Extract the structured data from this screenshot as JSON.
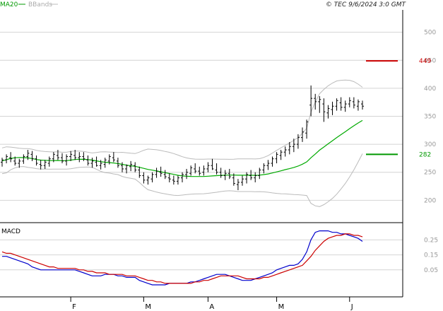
{
  "header": {
    "legend_items": [
      {
        "label": "MA20",
        "color": "#009900"
      },
      {
        "label": "BBands",
        "color": "#bbbbbb"
      }
    ],
    "timestamp": "© TEC 9/6/2024 3:0 GMT"
  },
  "chart_data": [
    {
      "type": "line",
      "name": "price-panel",
      "ylim": [
        160,
        540
      ],
      "y_ticks": [
        200,
        250,
        300,
        350,
        400,
        450,
        500
      ],
      "y_tick_labels": [
        "200",
        "250",
        "300",
        "350",
        "400",
        "450",
        "500"
      ],
      "x_tick_labels": [
        "F",
        "M",
        "A",
        "M",
        "J"
      ],
      "grid": true,
      "price_bars": [
        [
          268,
          276,
          260,
          272
        ],
        [
          272,
          282,
          266,
          278
        ],
        [
          276,
          286,
          268,
          274
        ],
        [
          270,
          278,
          262,
          266
        ],
        [
          266,
          274,
          258,
          270
        ],
        [
          270,
          282,
          265,
          278
        ],
        [
          278,
          290,
          272,
          284
        ],
        [
          282,
          288,
          270,
          274
        ],
        [
          274,
          280,
          262,
          266
        ],
        [
          264,
          272,
          255,
          262
        ],
        [
          262,
          272,
          256,
          268
        ],
        [
          266,
          278,
          260,
          274
        ],
        [
          274,
          286,
          268,
          282
        ],
        [
          280,
          290,
          272,
          276
        ],
        [
          276,
          284,
          266,
          270
        ],
        [
          270,
          282,
          262,
          278
        ],
        [
          278,
          288,
          270,
          282
        ],
        [
          280,
          290,
          272,
          276
        ],
        [
          276,
          286,
          268,
          278
        ],
        [
          278,
          286,
          270,
          274
        ],
        [
          272,
          280,
          262,
          266
        ],
        [
          266,
          276,
          258,
          270
        ],
        [
          268,
          278,
          260,
          262
        ],
        [
          262,
          272,
          255,
          266
        ],
        [
          264,
          276,
          258,
          272
        ],
        [
          270,
          282,
          264,
          278
        ],
        [
          276,
          286,
          268,
          272
        ],
        [
          270,
          276,
          258,
          262
        ],
        [
          262,
          268,
          250,
          256
        ],
        [
          256,
          264,
          248,
          262
        ],
        [
          260,
          270,
          252,
          264
        ],
        [
          262,
          268,
          250,
          254
        ],
        [
          254,
          260,
          240,
          244
        ],
        [
          244,
          250,
          230,
          236
        ],
        [
          236,
          244,
          228,
          240
        ],
        [
          238,
          250,
          232,
          246
        ],
        [
          246,
          258,
          240,
          252
        ],
        [
          250,
          260,
          242,
          248
        ],
        [
          246,
          254,
          238,
          242
        ],
        [
          240,
          248,
          232,
          238
        ],
        [
          236,
          244,
          228,
          234
        ],
        [
          234,
          244,
          228,
          240
        ],
        [
          240,
          250,
          232,
          246
        ],
        [
          246,
          256,
          238,
          250
        ],
        [
          248,
          262,
          244,
          258
        ],
        [
          256,
          266,
          248,
          252
        ],
        [
          252,
          260,
          244,
          248
        ],
        [
          250,
          262,
          244,
          256
        ],
        [
          256,
          268,
          250,
          262
        ],
        [
          262,
          274,
          254,
          256
        ],
        [
          254,
          266,
          246,
          250
        ],
        [
          250,
          258,
          240,
          244
        ],
        [
          244,
          254,
          236,
          248
        ],
        [
          248,
          256,
          238,
          242
        ],
        [
          240,
          248,
          226,
          230
        ],
        [
          228,
          238,
          218,
          232
        ],
        [
          232,
          244,
          226,
          238
        ],
        [
          238,
          250,
          230,
          246
        ],
        [
          244,
          254,
          236,
          240
        ],
        [
          240,
          250,
          232,
          244
        ],
        [
          244,
          258,
          238,
          254
        ],
        [
          254,
          266,
          248,
          262
        ],
        [
          262,
          272,
          254,
          266
        ],
        [
          266,
          278,
          260,
          274
        ],
        [
          274,
          286,
          266,
          282
        ],
        [
          280,
          290,
          272,
          286
        ],
        [
          286,
          296,
          278,
          290
        ],
        [
          290,
          304,
          282,
          296
        ],
        [
          296,
          310,
          286,
          300
        ],
        [
          300,
          318,
          292,
          312
        ],
        [
          312,
          330,
          304,
          322
        ],
        [
          320,
          344,
          310,
          340
        ],
        [
          370,
          405,
          350,
          382
        ],
        [
          382,
          390,
          362,
          376
        ],
        [
          376,
          386,
          356,
          380
        ],
        [
          372,
          382,
          340,
          358
        ],
        [
          356,
          370,
          346,
          364
        ],
        [
          362,
          376,
          352,
          368
        ],
        [
          368,
          382,
          360,
          378
        ],
        [
          374,
          384,
          360,
          366
        ],
        [
          366,
          378,
          358,
          372
        ],
        [
          372,
          384,
          366,
          378
        ],
        [
          376,
          384,
          364,
          370
        ],
        [
          368,
          380,
          360,
          376
        ],
        [
          372,
          378,
          362,
          368
        ]
      ],
      "series": [
        {
          "color": "#00aa00",
          "values": [
            270.4,
            272.2,
            274.7,
            275.9,
            276.4,
            276.2,
            275.6,
            274.5,
            272.8,
            271.7,
            271.4,
            271.0,
            270.9,
            271.1,
            270.7,
            270.7,
            271.7,
            272.7,
            273.3,
            273.1,
            272.6,
            271.7,
            270.3,
            269.0,
            268.0,
            267.3,
            266.4,
            265.5,
            264.1,
            262.7,
            261.6,
            260.6,
            258.9,
            257.0,
            255.1,
            253.8,
            252.3,
            250.9,
            249.3,
            247.8,
            246.2,
            244.6,
            243.5,
            242.9,
            242.6,
            242.4,
            242.4,
            242.5,
            243.0,
            243.5,
            243.9,
            244.4,
            244.9,
            245.0,
            245.0,
            244.7,
            244.7,
            244.7,
            244.7,
            244.5,
            244.8,
            245.8,
            247.0,
            248.7,
            250.7,
            252.6,
            254.7,
            256.5,
            258.6,
            261.0,
            264.4,
            268.6,
            275.9,
            282.6,
            289.5,
            295.1,
            300.8,
            306.3,
            312.0,
            317.2,
            322.4,
            327.9,
            333.1,
            338.0,
            342.5
          ]
        },
        {
          "color": "#bbbbbb",
          "values": [
            293.4,
            295.4,
            295.0,
            294.0,
            292.9,
            292.2,
            292.3,
            291.2,
            289.1,
            287.7,
            287.0,
            286.6,
            286.2,
            286.5,
            285.8,
            285.7,
            287.1,
            288.0,
            287.9,
            287.1,
            285.8,
            284.5,
            285.3,
            286.4,
            286.6,
            286.1,
            285.8,
            285.2,
            285.6,
            284.9,
            284.0,
            283.4,
            286.0,
            289.3,
            291.4,
            290.8,
            290.1,
            288.9,
            287.1,
            285.6,
            283.4,
            280.7,
            277.8,
            275.7,
            274.3,
            273.5,
            273.4,
            273.4,
            273.6,
            273.6,
            273.5,
            273.2,
            273.3,
            273.1,
            273.4,
            273.9,
            273.9,
            273.9,
            273.9,
            273.7,
            274.2,
            276.5,
            279.7,
            284.2,
            289.1,
            293.6,
            298.0,
            302.3,
            307.1,
            312.1,
            319.6,
            328.7,
            357.3,
            375.1,
            390.3,
            398.0,
            404.4,
            409.3,
            413.1,
            414.3,
            414.8,
            414.3,
            411.8,
            407.5,
            401.8
          ]
        },
        {
          "color": "#bbbbbb",
          "values": [
            247.4,
            249.0,
            254.4,
            257.8,
            259.9,
            260.2,
            258.9,
            257.8,
            256.5,
            255.7,
            255.8,
            255.4,
            255.6,
            255.7,
            255.6,
            255.7,
            256.3,
            257.4,
            258.7,
            259.1,
            259.4,
            258.9,
            255.3,
            251.6,
            249.4,
            248.5,
            247.0,
            245.8,
            242.6,
            240.5,
            239.2,
            237.8,
            231.8,
            224.7,
            218.8,
            216.8,
            214.5,
            212.9,
            211.5,
            210.0,
            209.0,
            208.5,
            209.2,
            210.1,
            210.9,
            211.3,
            211.4,
            211.6,
            212.4,
            213.4,
            214.3,
            215.6,
            216.5,
            216.9,
            216.6,
            215.5,
            215.5,
            215.5,
            215.5,
            215.3,
            215.4,
            215.1,
            214.3,
            213.2,
            212.3,
            211.6,
            211.4,
            210.7,
            210.1,
            209.9,
            209.2,
            208.5,
            194.5,
            190.1,
            188.7,
            192.2,
            197.2,
            203.3,
            210.9,
            220.1,
            230.0,
            241.5,
            254.4,
            268.5,
            283.2
          ]
        }
      ],
      "annotations": [
        {
          "label": "449",
          "value": 449,
          "color": "#cc0000"
        },
        {
          "label": "282",
          "value": 282,
          "color": "#009900"
        }
      ]
    },
    {
      "type": "line",
      "name": "macd-panel",
      "title": "MACD",
      "ylim": [
        -0.13,
        0.36
      ],
      "y_ticks": [
        0.05,
        0.15,
        0.25
      ],
      "y_tick_labels": [
        "0.05",
        "0.15",
        "0.25"
      ],
      "grid": true,
      "series": [
        {
          "color": "#0000cc",
          "values": [
            0.14,
            0.14,
            0.13,
            0.12,
            0.11,
            0.1,
            0.09,
            0.07,
            0.06,
            0.05,
            0.05,
            0.05,
            0.05,
            0.05,
            0.05,
            0.05,
            0.05,
            0.05,
            0.04,
            0.03,
            0.02,
            0.01,
            0.01,
            0.01,
            0.02,
            0.02,
            0.02,
            0.01,
            0.01,
            0.0,
            0.0,
            0.0,
            -0.02,
            -0.03,
            -0.04,
            -0.05,
            -0.05,
            -0.05,
            -0.05,
            -0.04,
            -0.04,
            -0.04,
            -0.04,
            -0.04,
            -0.03,
            -0.03,
            -0.02,
            -0.01,
            0.0,
            0.01,
            0.02,
            0.02,
            0.02,
            0.01,
            0.0,
            -0.01,
            -0.02,
            -0.02,
            -0.02,
            -0.01,
            0.0,
            0.01,
            0.02,
            0.03,
            0.05,
            0.06,
            0.07,
            0.08,
            0.08,
            0.09,
            0.12,
            0.17,
            0.25,
            0.3,
            0.31,
            0.31,
            0.31,
            0.3,
            0.3,
            0.29,
            0.29,
            0.28,
            0.27,
            0.26,
            0.24
          ]
        },
        {
          "color": "#cc0000",
          "values": [
            0.17,
            0.16,
            0.16,
            0.15,
            0.14,
            0.13,
            0.12,
            0.11,
            0.1,
            0.09,
            0.08,
            0.07,
            0.07,
            0.06,
            0.06,
            0.06,
            0.06,
            0.06,
            0.05,
            0.05,
            0.04,
            0.04,
            0.03,
            0.03,
            0.03,
            0.02,
            0.02,
            0.02,
            0.02,
            0.01,
            0.01,
            0.01,
            0.0,
            -0.01,
            -0.02,
            -0.02,
            -0.03,
            -0.03,
            -0.04,
            -0.04,
            -0.04,
            -0.04,
            -0.04,
            -0.04,
            -0.04,
            -0.03,
            -0.03,
            -0.02,
            -0.02,
            -0.01,
            0.0,
            0.01,
            0.01,
            0.01,
            0.01,
            0.01,
            0.0,
            -0.01,
            -0.01,
            -0.01,
            -0.01,
            0.0,
            0.0,
            0.01,
            0.02,
            0.03,
            0.04,
            0.05,
            0.06,
            0.07,
            0.08,
            0.11,
            0.14,
            0.18,
            0.21,
            0.24,
            0.26,
            0.27,
            0.28,
            0.28,
            0.29,
            0.29,
            0.28,
            0.28,
            0.27
          ]
        }
      ]
    }
  ]
}
